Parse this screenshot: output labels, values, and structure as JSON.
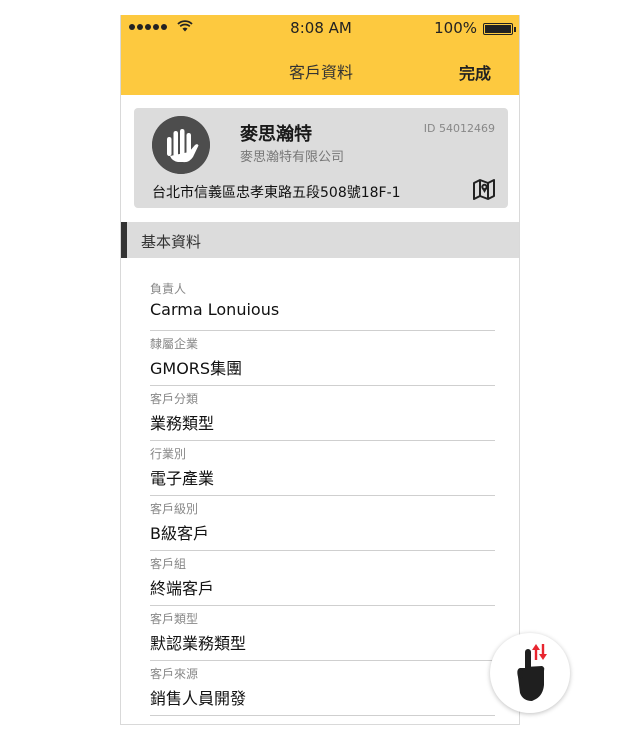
{
  "status_bar": {
    "time": "8:08 AM",
    "battery": "100%",
    "signal_dots": 5,
    "battery_level": 1.0
  },
  "nav": {
    "title": "客戶資料",
    "done_label": "完成"
  },
  "customer": {
    "name": "麥思瀚特",
    "company": "麥思瀚特有限公司",
    "id": "ID 54012469",
    "address": "台北市信義區忠孝東路五段508號18F-1"
  },
  "section": {
    "title": "基本資料"
  },
  "fields": [
    {
      "label": "負責人",
      "value": "Carma Lonuious"
    },
    {
      "label": "隸屬企業",
      "value": "GMORS集團"
    },
    {
      "label": "客戶分類",
      "value": "業務類型"
    },
    {
      "label": "行業別",
      "value": "電子產業"
    },
    {
      "label": "客戶級別",
      "value": "B級客戶"
    },
    {
      "label": "客戶組",
      "value": "終端客戶"
    },
    {
      "label": "客戶類型",
      "value": "默認業務類型"
    },
    {
      "label": "客戶來源",
      "value": "銷售人員開發"
    }
  ],
  "icons": {
    "avatar": "hand-logo-icon",
    "map": "map-icon",
    "gesture": "swipe-updown-gesture-icon"
  },
  "colors": {
    "header_bg": "#fdc93f",
    "card_bg": "#dcdcdc",
    "gesture_arrow": "#e8252f"
  }
}
